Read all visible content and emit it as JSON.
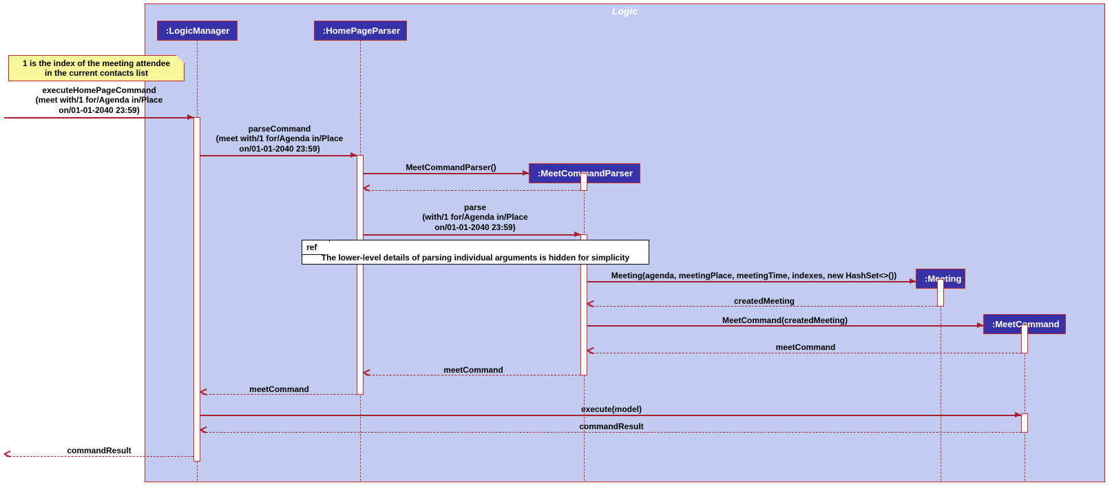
{
  "frame": {
    "title": "Logic"
  },
  "participants": {
    "logicManager": ":LogicManager",
    "homePageParser": ":HomePageParser",
    "meetCommandParser": ":MeetCommandParser",
    "meeting": ":Meeting",
    "meetCommand": ":MeetCommand"
  },
  "note": {
    "line1": "1 is the index of the meeting attendee",
    "line2": "in the current contacts list"
  },
  "messages": {
    "executeTitle": "executeHomePageCommand",
    "executeArgs1": "(meet with/1 for/Agenda in/Place",
    "executeArgs2": "on/01-01-2040 23:59)",
    "parseTitle": "parseCommand",
    "parseArgs1": "(meet with/1 for/Agenda in/Place",
    "parseArgs2": "on/01-01-2040 23:59)",
    "mcpCtor": "MeetCommandParser()",
    "parseMethod": "parse",
    "parseMethodArgs1": "(with/1 for/Agenda in/Place",
    "parseMethodArgs2": "on/01-01-2040 23:59)",
    "meetingCtor": "Meeting(agenda, meetingPlace, meetingTime, indexes, new HashSet<>())",
    "createdMeeting": "createdMeeting",
    "meetCmdCtor": "MeetCommand(createdMeeting)",
    "retMeetCommand": "meetCommand",
    "execute": "execute(model)",
    "commandResult": "commandResult"
  },
  "ref": {
    "tab": "ref",
    "text": "The lower-level details of parsing individual arguments is hidden for simplicity"
  }
}
